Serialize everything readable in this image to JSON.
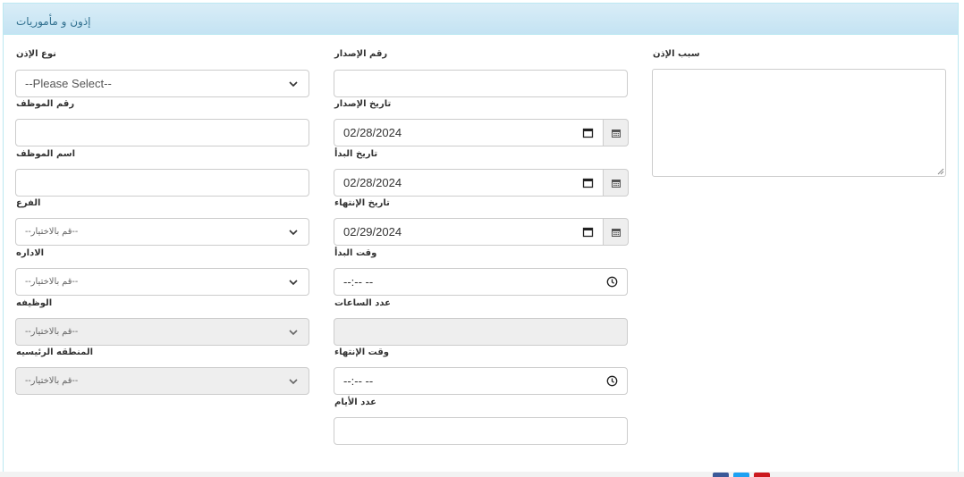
{
  "panel": {
    "title": "إذون و مأموريات"
  },
  "form": {
    "permission_type_label": "نوع الإذن",
    "permission_type_value": "--Please Select--",
    "issue_number_label": "رقم الإصدار",
    "reason_label": "سبب الإذن",
    "employee_number_label": "رقم الموظف",
    "issue_date_label": "تاريخ الإصدار",
    "issue_date_value": "02/28/2024",
    "employee_name_label": "اسم الموظف",
    "start_date_label": "تاريخ البدأ",
    "start_date_value": "02/28/2024",
    "branch_label": "الفرع",
    "branch_value": "--قم بالاختيار--",
    "end_date_label": "تاريخ الإنتهاء",
    "end_date_value": "02/29/2024",
    "department_label": "الاداره",
    "department_value": "--قم بالاختيار--",
    "start_time_label": "وقت البدأ",
    "start_time_value": "--:-- --",
    "job_label": "الوظيفه",
    "job_value": "--قم بالاختيار--",
    "hours_count_label": "عدد الساعات",
    "main_region_label": "المنطقه الرئيسيه",
    "main_region_value": "--قم بالاختيار--",
    "end_time_label": "وقت الإنتهاء",
    "end_time_value": "--:-- --",
    "days_count_label": "عدد الأيام"
  },
  "icons": {
    "calendar": "calendar-icon",
    "addon_calendar": "calendar-addon-icon",
    "clock": "clock-icon",
    "chevron": "chevron-down-icon"
  },
  "colors": {
    "heading_bg": "#d9edf7",
    "heading_text": "#31708f",
    "border": "#cccccc",
    "disabled_bg": "#eeeeee",
    "facebook": "#3b5998",
    "twitter": "#1da1f2",
    "youtube": "#cc181e"
  }
}
